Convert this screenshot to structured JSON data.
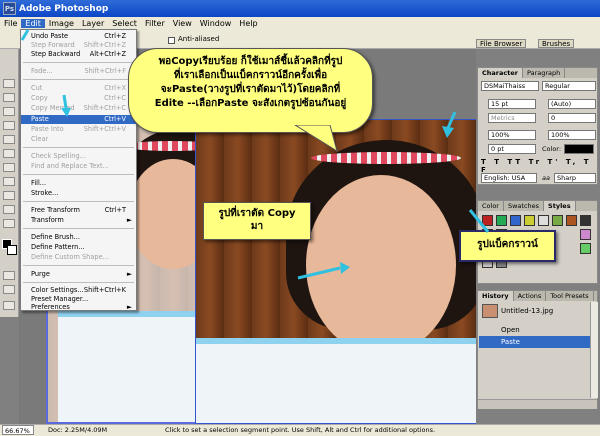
{
  "window": {
    "title": "Adobe Photoshop",
    "ps_badge": "Ps"
  },
  "menubar": {
    "items": [
      "File",
      "Edit",
      "Image",
      "Layer",
      "Select",
      "Filter",
      "View",
      "Window",
      "Help"
    ]
  },
  "options": {
    "anti_aliased": "Anti-aliased",
    "file_browser": "File Browser",
    "brushes": "Brushes"
  },
  "edit_menu": {
    "items": [
      {
        "label": "Undo Paste",
        "shortcut": "Ctrl+Z"
      },
      {
        "label": "Step Forward",
        "shortcut": "Shift+Ctrl+Z"
      },
      {
        "label": "Step Backward",
        "shortcut": "Alt+Ctrl+Z"
      },
      {
        "label": "Fade...",
        "shortcut": "Shift+Ctrl+F"
      },
      {
        "label": "Cut",
        "shortcut": "Ctrl+X"
      },
      {
        "label": "Copy",
        "shortcut": "Ctrl+C"
      },
      {
        "label": "Copy Merged",
        "shortcut": "Shift+Ctrl+C"
      },
      {
        "label": "Paste",
        "shortcut": "Ctrl+V"
      },
      {
        "label": "Paste Into",
        "shortcut": "Shift+Ctrl+V"
      },
      {
        "label": "Clear",
        "shortcut": ""
      },
      {
        "label": "Check Spelling...",
        "shortcut": ""
      },
      {
        "label": "Find and Replace Text...",
        "shortcut": ""
      },
      {
        "label": "Fill...",
        "shortcut": ""
      },
      {
        "label": "Stroke...",
        "shortcut": ""
      },
      {
        "label": "Free Transform",
        "shortcut": "Ctrl+T"
      },
      {
        "label": "Transform",
        "shortcut": ""
      },
      {
        "label": "Define Brush...",
        "shortcut": ""
      },
      {
        "label": "Define Pattern...",
        "shortcut": ""
      },
      {
        "label": "Define Custom Shape...",
        "shortcut": ""
      },
      {
        "label": "Purge",
        "shortcut": ""
      },
      {
        "label": "Color Settings...",
        "shortcut": "Shift+Ctrl+K"
      },
      {
        "label": "Preset Manager...",
        "shortcut": ""
      },
      {
        "label": "Preferences",
        "shortcut": ""
      }
    ]
  },
  "callouts": {
    "main_line1": "พอCopyเรียบร้อย ก็ใช้เมาส์ชี้แล้วคลิกที่รูป",
    "main_line2": "ที่เราเลือกเป็นแบ็คกราวน์อีกครั้งเพื่อ",
    "main_line3": "จะPaste(วางรูปที่เราตัดมาไว้)โดยคลิกที่",
    "main_line4": "Edite --เลือกPaste จะสังเกตรูปซ้อนกันอยู่",
    "cut_line1": "รูปที่เราตัด Copy",
    "cut_line2": "มา",
    "background": "รูปแบ็คกราวน์"
  },
  "character_panel": {
    "tab_character": "Character",
    "tab_paragraph": "Paragraph",
    "font_family": "DSMaiThaiss",
    "font_style": "Regular",
    "font_size": "15 pt",
    "leading": "(Auto)",
    "kerning": "Metrics",
    "tracking": "0",
    "vscale": "100%",
    "hscale": "100%",
    "baseline": "0 pt",
    "color_label": "Color:",
    "language": "English: USA",
    "aa_prefix": "aa",
    "antialias": "Sharp"
  },
  "color_panel": {
    "tab_color": "Color",
    "tab_swatches": "Swatches",
    "tab_styles": "Styles"
  },
  "history_panel": {
    "tab_history": "History",
    "tab_actions": "Actions",
    "tab_presets": "Tool Presets",
    "snapshot": "Untitled-13.jpg",
    "steps": [
      "Open",
      "Paste"
    ]
  },
  "status": {
    "zoom": "66.67%",
    "doc": "Doc: 2.25M/4.09M",
    "hint": "Click to set a selection segment point. Use Shift, Alt and Ctrl for additional options."
  },
  "colors": {
    "menu_highlight": "#316ac5",
    "callout_fill": "#ffff80",
    "arrow": "#30c0e0"
  }
}
